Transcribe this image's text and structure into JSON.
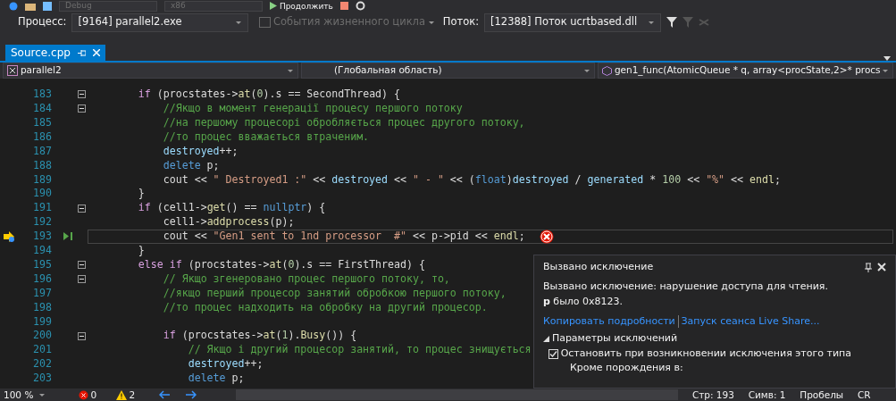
{
  "toolbar": {
    "configuration": "Debug",
    "platform": "x86",
    "continue_button": "Продолжить"
  },
  "debug_location": {
    "process_label": "Процесс:",
    "process": "[9164] parallel2.exe",
    "lifecycle": {
      "label": "События жизненного цикла",
      "disabled": true
    },
    "thread_label": "Поток:",
    "thread": "[12388] Поток ucrtbased.dll"
  },
  "tabs": [
    {
      "label": "Source.cpp",
      "selected": true
    }
  ],
  "navigation": {
    "project": "parallel2",
    "scope": "(Глобальная область)",
    "member": "gen1_func(AtomicQueue * q, array<procState,2>* procs"
  },
  "code_lines": [
    {
      "number": "183",
      "fold": true,
      "current": false,
      "tokens": [
        {
          "kind": "control",
          "text": "        if"
        },
        {
          "kind": "plain",
          "text": " (procstates->"
        },
        {
          "kind": "function",
          "text": "at"
        },
        {
          "kind": "plain",
          "text": "("
        },
        {
          "kind": "number",
          "text": "0"
        },
        {
          "kind": "plain",
          "text": ").s == SecondThread) {"
        }
      ]
    },
    {
      "number": "184",
      "fold": true,
      "current": false,
      "tokens": [
        {
          "kind": "comment",
          "text": "            //Якщо в момент генерації процесу першого потоку"
        }
      ]
    },
    {
      "number": "185",
      "fold": false,
      "current": false,
      "tokens": [
        {
          "kind": "comment",
          "text": "            //на першому процесорі обробляється процес другого потоку,"
        }
      ]
    },
    {
      "number": "186",
      "fold": false,
      "current": false,
      "tokens": [
        {
          "kind": "comment",
          "text": "            //то процес вважається втраченим."
        }
      ]
    },
    {
      "number": "187",
      "fold": false,
      "current": false,
      "tokens": [
        {
          "kind": "variable",
          "text": "            destroyed"
        },
        {
          "kind": "plain",
          "text": "++;"
        }
      ]
    },
    {
      "number": "188",
      "fold": false,
      "current": false,
      "tokens": [
        {
          "kind": "keyword",
          "text": "            delete"
        },
        {
          "kind": "plain",
          "text": " p;"
        }
      ]
    },
    {
      "number": "189",
      "fold": false,
      "current": false,
      "tokens": [
        {
          "kind": "plain",
          "text": "            cout << "
        },
        {
          "kind": "string",
          "text": "\" Destroyed1 :\""
        },
        {
          "kind": "plain",
          "text": " << "
        },
        {
          "kind": "variable",
          "text": "destroyed"
        },
        {
          "kind": "plain",
          "text": " << "
        },
        {
          "kind": "string",
          "text": "\" - \""
        },
        {
          "kind": "plain",
          "text": " << ("
        },
        {
          "kind": "keyword",
          "text": "float"
        },
        {
          "kind": "plain",
          "text": ")"
        },
        {
          "kind": "variable",
          "text": "destroyed"
        },
        {
          "kind": "plain",
          "text": " / "
        },
        {
          "kind": "variable",
          "text": "generated"
        },
        {
          "kind": "plain",
          "text": " * "
        },
        {
          "kind": "number",
          "text": "100"
        },
        {
          "kind": "plain",
          "text": " << "
        },
        {
          "kind": "string",
          "text": "\"%\""
        },
        {
          "kind": "plain",
          "text": " << "
        },
        {
          "kind": "function",
          "text": "endl"
        },
        {
          "kind": "plain",
          "text": ";"
        }
      ]
    },
    {
      "number": "190",
      "fold": false,
      "current": false,
      "tokens": [
        {
          "kind": "plain",
          "text": "        }"
        }
      ]
    },
    {
      "number": "191",
      "fold": true,
      "current": false,
      "tokens": [
        {
          "kind": "control",
          "text": "        if"
        },
        {
          "kind": "plain",
          "text": " (cell1->"
        },
        {
          "kind": "function",
          "text": "get"
        },
        {
          "kind": "plain",
          "text": "() == "
        },
        {
          "kind": "keyword",
          "text": "nullptr"
        },
        {
          "kind": "plain",
          "text": ") {"
        }
      ]
    },
    {
      "number": "192",
      "fold": false,
      "current": false,
      "tokens": [
        {
          "kind": "plain",
          "text": "            cell1->"
        },
        {
          "kind": "function",
          "text": "addprocess"
        },
        {
          "kind": "plain",
          "text": "(p);"
        }
      ]
    },
    {
      "number": "193",
      "fold": false,
      "current": true,
      "tokens": [
        {
          "kind": "plain",
          "text": "            cout << "
        },
        {
          "kind": "string",
          "text": "\"Gen1 sent to 1nd processor  #\""
        },
        {
          "kind": "plain",
          "text": " << p->pid << "
        },
        {
          "kind": "function",
          "text": "endl"
        },
        {
          "kind": "plain",
          "text": ";"
        }
      ]
    },
    {
      "number": "194",
      "fold": false,
      "current": false,
      "tokens": [
        {
          "kind": "plain",
          "text": "        }"
        }
      ]
    },
    {
      "number": "195",
      "fold": true,
      "current": false,
      "tokens": [
        {
          "kind": "control",
          "text": "        else if"
        },
        {
          "kind": "plain",
          "text": " (procstates->"
        },
        {
          "kind": "function",
          "text": "at"
        },
        {
          "kind": "plain",
          "text": "("
        },
        {
          "kind": "number",
          "text": "0"
        },
        {
          "kind": "plain",
          "text": ").s == FirstThread) {"
        }
      ]
    },
    {
      "number": "196",
      "fold": true,
      "current": false,
      "tokens": [
        {
          "kind": "comment",
          "text": "            // Якщо згенеровано процес першого потоку, то,"
        }
      ]
    },
    {
      "number": "197",
      "fold": false,
      "current": false,
      "tokens": [
        {
          "kind": "comment",
          "text": "            //якщо перший процесор занятий обробкою першого потоку,"
        }
      ]
    },
    {
      "number": "198",
      "fold": false,
      "current": false,
      "tokens": [
        {
          "kind": "comment",
          "text": "            //то процес надходить на обробку на другий процесор."
        }
      ]
    },
    {
      "number": "199",
      "fold": false,
      "current": false
    },
    {
      "number": "200",
      "fold": true,
      "current": false,
      "tokens": [
        {
          "kind": "control",
          "text": "            if"
        },
        {
          "kind": "plain",
          "text": " (procstates->"
        },
        {
          "kind": "function",
          "text": "at"
        },
        {
          "kind": "plain",
          "text": "("
        },
        {
          "kind": "number",
          "text": "1"
        },
        {
          "kind": "plain",
          "text": ")."
        },
        {
          "kind": "function",
          "text": "Busy"
        },
        {
          "kind": "plain",
          "text": "()) {"
        }
      ]
    },
    {
      "number": "201",
      "fold": false,
      "current": false,
      "tokens": [
        {
          "kind": "comment",
          "text": "                // Якщо і другий процесор занятий, то процес знищується"
        }
      ]
    },
    {
      "number": "202",
      "fold": false,
      "current": false,
      "tokens": [
        {
          "kind": "variable",
          "text": "                destroyed"
        },
        {
          "kind": "plain",
          "text": "++;"
        }
      ]
    },
    {
      "number": "203",
      "fold": false,
      "current": false,
      "tokens": [
        {
          "kind": "keyword",
          "text": "                delete"
        },
        {
          "kind": "plain",
          "text": " p;"
        }
      ]
    }
  ],
  "exception_popup": {
    "title": "Вызвано исключение",
    "message": "Вызвано исключение: нарушение доступа для чтения.",
    "detail": "**p** было 0x8123.",
    "links": [
      "Копировать подробности",
      "Запуск сеанса Live Share..."
    ],
    "settings": {
      "label": "Параметры исключений",
      "expanded": true
    },
    "break_option": {
      "label": "Остановить при возникновении исключения этого типа",
      "checked": true
    },
    "except_label": "Кроме порождения в:"
  },
  "status_bar": {
    "zoom": "100 %",
    "errors": "0",
    "warnings": "2",
    "line": "Стр: 193",
    "column": "Симв: 1",
    "indent": "Пробелы",
    "line_ending": "CR"
  }
}
